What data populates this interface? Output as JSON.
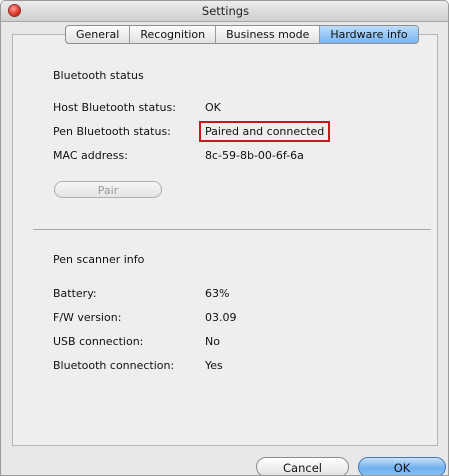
{
  "window": {
    "title": "Settings"
  },
  "tabs": [
    {
      "label": "General",
      "active": false
    },
    {
      "label": "Recognition",
      "active": false
    },
    {
      "label": "Business mode",
      "active": false
    },
    {
      "label": "Hardware info",
      "active": true
    }
  ],
  "bluetooth": {
    "heading": "Bluetooth status",
    "rows": [
      {
        "label": "Host Bluetooth status:",
        "value": "OK"
      },
      {
        "label": "Pen Bluetooth status:",
        "value": "Paired and connected"
      },
      {
        "label": "MAC address:",
        "value": "8c-59-8b-00-6f-6a"
      }
    ],
    "pair_label": "Pair"
  },
  "scanner": {
    "heading": "Pen scanner info",
    "rows": [
      {
        "label": "Battery:",
        "value": "63%"
      },
      {
        "label": "F/W version:",
        "value": "03.09"
      },
      {
        "label": "USB connection:",
        "value": "No"
      },
      {
        "label": "Bluetooth connection:",
        "value": "Yes"
      }
    ]
  },
  "footer": {
    "cancel_label": "Cancel",
    "ok_label": "OK"
  },
  "colors": {
    "highlight": "#d0121b",
    "active_tab": "#78b6ef"
  }
}
